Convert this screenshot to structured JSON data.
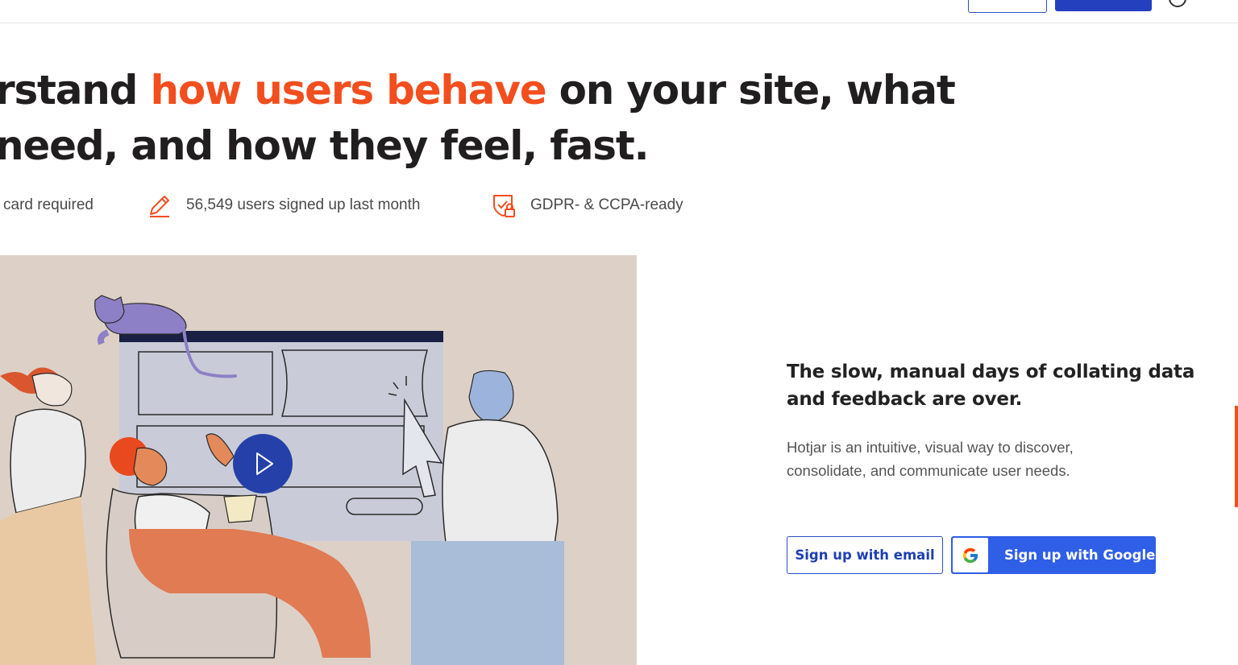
{
  "headline": {
    "line1_before": "rstand ",
    "line1_accent": "how users behave",
    "line1_after": " on your site, what",
    "line2": "need, and how they feel, fast."
  },
  "trust": [
    {
      "icon": "credit-card-icon",
      "text": "card required"
    },
    {
      "icon": "pencil-icon",
      "text": "56,549 users signed up last month"
    },
    {
      "icon": "shield-lock-icon",
      "text": "GDPR- & CCPA-ready"
    }
  ],
  "hero": {
    "subheading": "The slow, manual days of collating data and feedback are over.",
    "description": "Hotjar is an intuitive, visual way to discover, consolidate, and communicate user needs.",
    "email_button": "Sign up with email",
    "google_button": "Sign up with Google"
  },
  "colors": {
    "accent": "#f24e1e",
    "brand_blue": "#2f5ee7",
    "illustration_bg": "#ddd0c7"
  }
}
